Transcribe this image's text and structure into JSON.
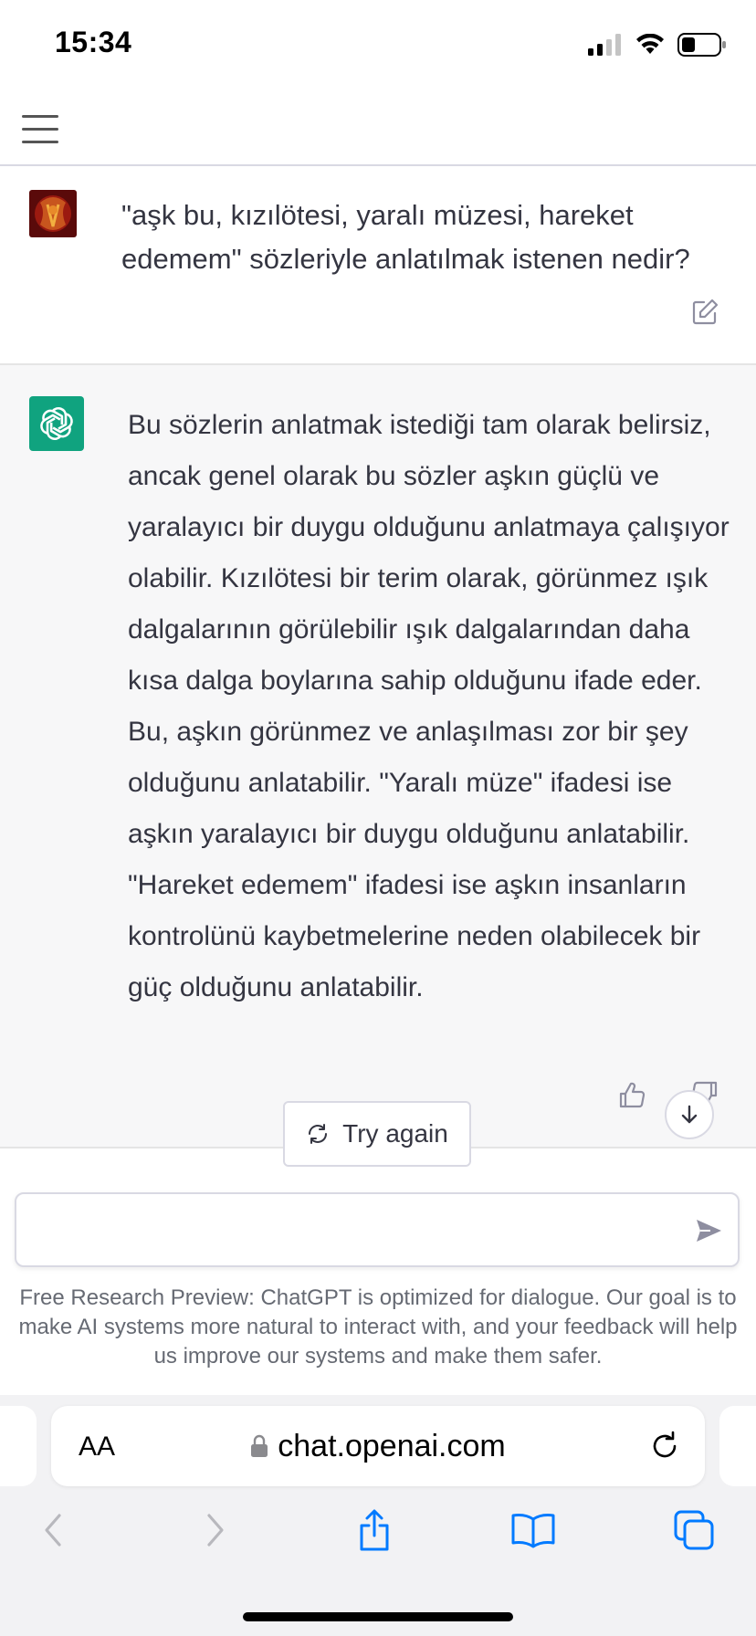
{
  "status": {
    "time": "15:34"
  },
  "conversation": {
    "user_message": "\"aşk bu, kızılötesi, yaralı müzesi, hareket edemem\" sözleriyle anlatılmak istenen nedir?",
    "assistant_message": "Bu sözlerin anlatmak istediği tam olarak belirsiz, ancak genel olarak bu sözler aşkın güçlü ve yaralayıcı bir duygu olduğunu anlatmaya çalışıyor olabilir. Kızılötesi bir terim olarak, görünmez ışık dalgalarının görülebilir ışık dalgalarından daha kısa dalga boylarına sahip olduğunu ifade eder. Bu, aşkın görünmez ve anlaşılması zor bir şey olduğunu anlatabilir. \"Yaralı müze\" ifadesi ise aşkın yaralayıcı bir duygu olduğunu anlatabilir. \"Hareket edemem\" ifadesi ise aşkın insanların kontrolünü kaybetmelerine neden olabilecek bir güç olduğunu anlatabilir."
  },
  "composer": {
    "try_again_label": "Try again",
    "input_value": "",
    "input_placeholder": "",
    "disclaimer": "Free Research Preview: ChatGPT is optimized for dialogue. Our goal is to make AI systems more natural to interact with, and your feedback will help us improve our systems and make them safer."
  },
  "browser": {
    "text_size_label": "AA",
    "url": "chat.openai.com"
  },
  "icons": {
    "menu": "hamburger-icon",
    "edit": "edit-icon",
    "assistant_logo": "openai-logo-icon",
    "thumbs_up": "thumbs-up-icon",
    "thumbs_down": "thumbs-down-icon",
    "scroll_down": "arrow-down-icon",
    "regenerate": "refresh-icon",
    "send": "send-icon",
    "lock": "lock-icon",
    "reload": "reload-icon",
    "back": "chevron-left-icon",
    "forward": "chevron-right-icon",
    "share": "share-icon",
    "bookmarks": "book-icon",
    "tabs": "tabs-icon"
  },
  "colors": {
    "accent": "#10a37f",
    "ios_blue": "#007aff",
    "assistant_bg": "#f7f7f8",
    "text": "#343541"
  }
}
